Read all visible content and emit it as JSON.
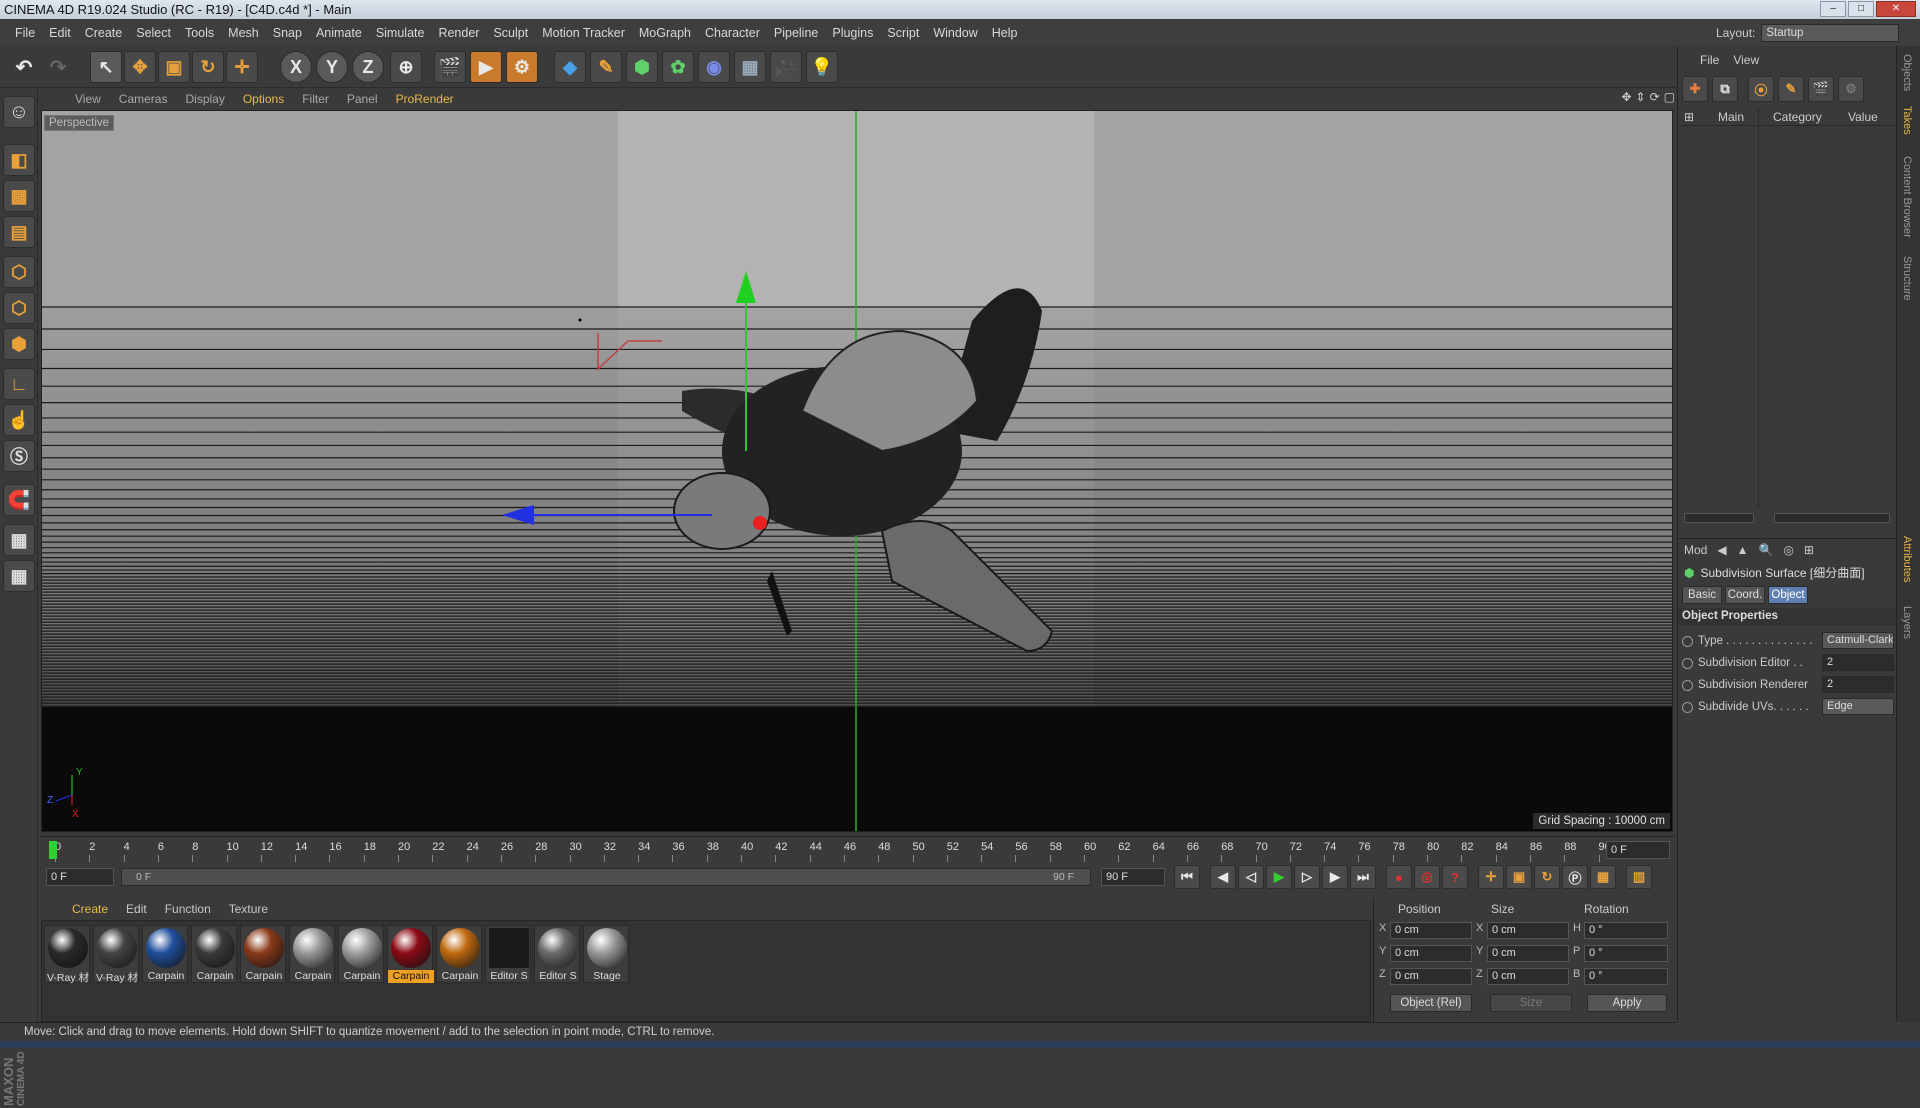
{
  "window": {
    "title": "CINEMA 4D R19.024 Studio (RC - R19) - [C4D.c4d *] - Main"
  },
  "menubar": [
    "File",
    "Edit",
    "Create",
    "Select",
    "Tools",
    "Mesh",
    "Snap",
    "Animate",
    "Simulate",
    "Render",
    "Sculpt",
    "Motion Tracker",
    "MoGraph",
    "Character",
    "Pipeline",
    "Plugins",
    "Script",
    "Window",
    "Help"
  ],
  "layout": {
    "label": "Layout:",
    "value": "Startup"
  },
  "toolbar": {
    "axis_x": "X",
    "axis_y": "Y",
    "axis_z": "Z"
  },
  "viewport": {
    "menu": [
      "View",
      "Cameras",
      "Display",
      "Options",
      "Filter",
      "Panel",
      "ProRender"
    ],
    "camera_label": "Perspective",
    "grid_spacing": "Grid Spacing : 10000 cm",
    "axis_y": "Y",
    "axis_z": "Z",
    "axis_x": "X"
  },
  "timeline": {
    "ticks": [
      "0",
      "2",
      "4",
      "6",
      "8",
      "10",
      "12",
      "14",
      "16",
      "18",
      "20",
      "22",
      "24",
      "26",
      "28",
      "30",
      "32",
      "34",
      "36",
      "38",
      "40",
      "42",
      "44",
      "46",
      "48",
      "50",
      "52",
      "54",
      "56",
      "58",
      "60",
      "62",
      "64",
      "66",
      "68",
      "70",
      "72",
      "74",
      "76",
      "78",
      "80",
      "82",
      "84",
      "86",
      "88",
      "90"
    ],
    "current_frame": "0 F",
    "start": "0 F",
    "range_start": "0 F",
    "range_end": "90 F",
    "end": "90 F"
  },
  "materials": {
    "menu": [
      "Create",
      "Edit",
      "Function",
      "Texture"
    ],
    "items": [
      {
        "label": "V-Ray 材",
        "color": "#2a2a2a",
        "selected": false
      },
      {
        "label": "V-Ray 材",
        "color": "#444444",
        "selected": false
      },
      {
        "label": "Carpain",
        "color": "#1f4f9c",
        "selected": false
      },
      {
        "label": "Carpain",
        "color": "#3a3a3a",
        "selected": false
      },
      {
        "label": "Carpain",
        "color": "#8a3a1a",
        "selected": false
      },
      {
        "label": "Carpain",
        "color": "#9a9a9a",
        "selected": false
      },
      {
        "label": "Carpain",
        "color": "#a0a0a0",
        "selected": false
      },
      {
        "label": "Carpain",
        "color": "#8a0a14",
        "selected": true
      },
      {
        "label": "Carpain",
        "color": "#c06a10",
        "selected": false
      },
      {
        "label": "Editor S",
        "color": "#2a2a2a",
        "selected": false
      },
      {
        "label": "Editor S",
        "color": "#6a6a6a",
        "selected": false
      },
      {
        "label": "Stage",
        "color": "#9a9a9a",
        "selected": false
      }
    ]
  },
  "coords": {
    "headers": {
      "position": "Position",
      "size": "Size",
      "rotation": "Rotation"
    },
    "rows": [
      {
        "axis": "X",
        "pos": "0 cm",
        "saxis": "X",
        "size": "0 cm",
        "raxis": "H",
        "rot": "0 °"
      },
      {
        "axis": "Y",
        "pos": "0 cm",
        "saxis": "Y",
        "size": "0 cm",
        "raxis": "P",
        "rot": "0 °"
      },
      {
        "axis": "Z",
        "pos": "0 cm",
        "saxis": "Z",
        "size": "0 cm",
        "raxis": "B",
        "rot": "0 °"
      }
    ],
    "mode": "Object (Rel)",
    "size_mode": "Size",
    "apply": "Apply"
  },
  "objects": {
    "menu": [
      "File",
      "View"
    ],
    "columns": {
      "main": "Main",
      "category": "Category",
      "value": "Value"
    }
  },
  "attributes": {
    "mode": "Mod",
    "object_name": "Subdivision Surface [细分曲面]",
    "tabs": [
      "Basic",
      "Coord.",
      "Object"
    ],
    "section": "Object Properties",
    "props": [
      {
        "name": "Type . . . . . . . . . . . . . .",
        "value": "Catmull-Clark",
        "num": false
      },
      {
        "name": "Subdivision Editor . .",
        "value": "2",
        "num": true
      },
      {
        "name": "Subdivision Renderer",
        "value": "2",
        "num": true
      },
      {
        "name": "Subdivide UVs. . . . . .",
        "value": "Edge",
        "num": false
      }
    ]
  },
  "side_tabs": [
    "Objects",
    "Takes",
    "Content Browser",
    "Structure",
    "Attributes",
    "Layers"
  ],
  "status": "Move: Click and drag to move elements. Hold down SHIFT to quantize movement / add to the selection in point mode, CTRL to remove.",
  "brand": {
    "line1": "MAXON",
    "line2": "CINEMA 4D"
  }
}
